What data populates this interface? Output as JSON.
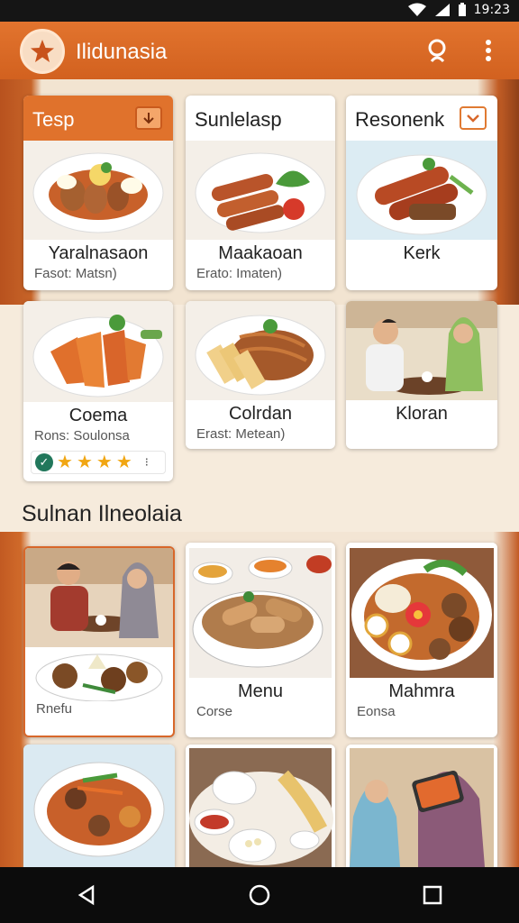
{
  "status_bar": {
    "time": "19:23",
    "icons": [
      "wifi-icon",
      "signal-icon",
      "battery-icon"
    ]
  },
  "app_bar": {
    "title": "Ilidunasia",
    "logo_icon": "star-logo-icon",
    "actions": [
      "search-icon",
      "more-vert-icon"
    ]
  },
  "colors": {
    "primary": "#e0722c",
    "header_dark": "#d2611f",
    "background": "#f6ebdc",
    "star": "#f1a612",
    "check": "#21775b"
  },
  "grid": [
    {
      "header": "Tesp",
      "header_icon": "download-icon",
      "title": "Yaralnasaon",
      "subtitle": "Fasot: Matsn)"
    },
    {
      "header": "Sunlelasp",
      "title": "Maakaoan",
      "subtitle": "Erato: Imaten)"
    },
    {
      "header": "Resonenk",
      "header_icon": "chevron-down-icon",
      "title": "Kerk",
      "subtitle": ""
    },
    {
      "title": "Coema",
      "subtitle": "Rons: Soulonsa",
      "rating": 4
    },
    {
      "title": "Colrdan",
      "subtitle": "Erast: Metean)"
    },
    {
      "title": "Kloran",
      "subtitle": ""
    }
  ],
  "section": {
    "title": "Sulnan Ilneolaia"
  },
  "list": [
    {
      "title": "",
      "subtitle": "Rnefu"
    },
    {
      "title": "Menu",
      "subtitle": "Corse"
    },
    {
      "title": "Mahmra",
      "subtitle": "Eonsa"
    }
  ],
  "nav": [
    "back-icon",
    "home-icon",
    "recents-icon"
  ]
}
